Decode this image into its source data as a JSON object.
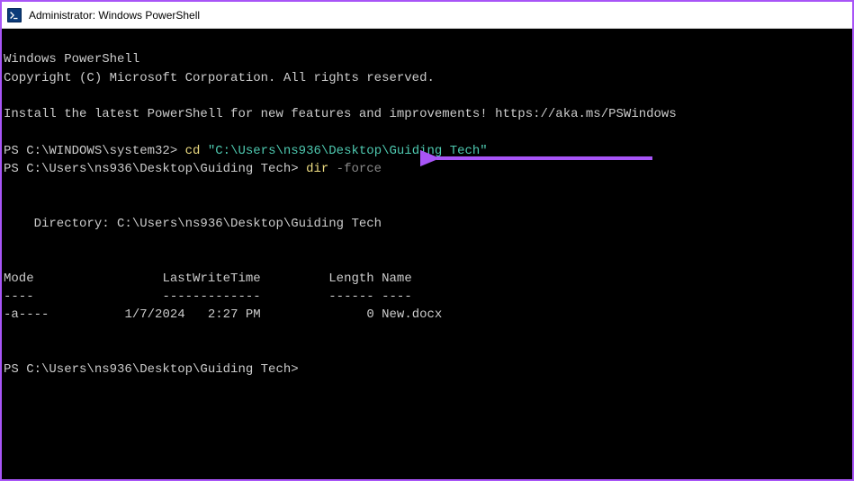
{
  "titlebar": {
    "title": "Administrator: Windows PowerShell"
  },
  "terminal": {
    "header1": "Windows PowerShell",
    "header2": "Copyright (C) Microsoft Corporation. All rights reserved.",
    "install_msg": "Install the latest PowerShell for new features and improvements! https://aka.ms/PSWindows",
    "line1": {
      "prompt": "PS C:\\WINDOWS\\system32> ",
      "cmd": "cd ",
      "arg": "\"C:\\Users\\ns936\\Desktop\\Guiding Tech\""
    },
    "line2": {
      "prompt": "PS C:\\Users\\ns936\\Desktop\\Guiding Tech> ",
      "cmd": "dir ",
      "param": "-force"
    },
    "dir_header": "    Directory: C:\\Users\\ns936\\Desktop\\Guiding Tech",
    "table": {
      "h_mode": "Mode",
      "h_lwt": "LastWriteTime",
      "h_len": "Length",
      "h_name": "Name",
      "sep_mode": "----",
      "sep_lwt": "-------------",
      "sep_len": "------",
      "sep_name": "----",
      "row1": {
        "mode": "-a----",
        "date": "1/7/2024",
        "time": "2:27 PM",
        "length": "0",
        "name": "New.docx"
      }
    },
    "line3_prompt": "PS C:\\Users\\ns936\\Desktop\\Guiding Tech>"
  },
  "annotation": {
    "arrow_color": "#a855f7"
  }
}
